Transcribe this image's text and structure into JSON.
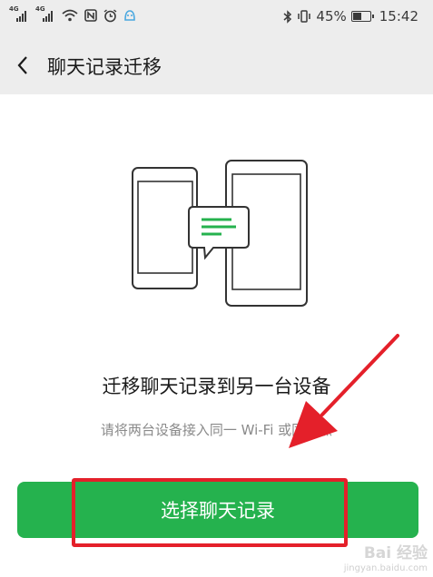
{
  "status_bar": {
    "network_1": "4G",
    "network_2": "4G",
    "battery": "45%",
    "time": "15:42"
  },
  "header": {
    "back_icon": "chevron-left-icon",
    "title": "聊天记录迁移"
  },
  "main": {
    "illustration": "two-phones-message-transfer",
    "heading": "迁移聊天记录到另一台设备",
    "subtitle": "请将两台设备接入同一 Wi-Fi 或同热点",
    "button_label": "选择聊天记录"
  },
  "colors": {
    "accent": "#25b24e",
    "annotation": "#e4202a",
    "header_bg": "#ededed"
  },
  "watermark": {
    "brand": "Bai 经验",
    "url": "jingyan.baidu.com"
  }
}
